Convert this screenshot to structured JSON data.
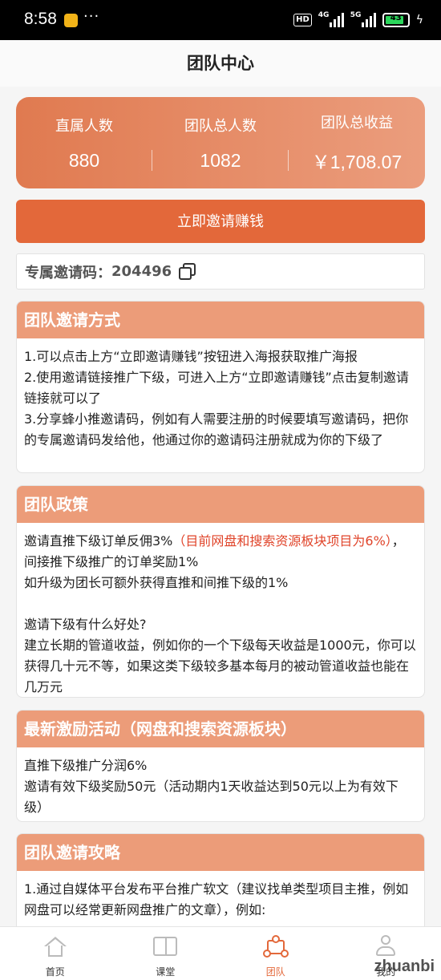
{
  "statusbar": {
    "time": "8:58",
    "dots": "···",
    "hd": "HD",
    "net1": "4G",
    "net2": "5G",
    "battery": "43",
    "bolt": "ϟ"
  },
  "header": {
    "title": "团队中心"
  },
  "stats": [
    {
      "label": "直属人数",
      "value": "880"
    },
    {
      "label": "团队总人数",
      "value": "1082"
    },
    {
      "label": "团队总收益",
      "value": "￥1,708.07"
    }
  ],
  "invite_button": "立即邀请赚钱",
  "invite_code": {
    "label": "专属邀请码：",
    "code": "204496"
  },
  "cards": {
    "methods": {
      "title": "团队邀请方式",
      "lines": [
        "1.可以点击上方“立即邀请赚钱”按钮进入海报获取推广海报",
        "2.使用邀请链接推广下级，可进入上方“立即邀请赚钱”点击复制邀请链接就可以了",
        "3.分享蜂小推邀请码，例如有人需要注册的时候要填写邀请码，把你的专属邀请码发给他，他通过你的邀请码注册就成为你的下级了"
      ]
    },
    "policy": {
      "title": "团队政策",
      "line1_a": "邀请直推下级订单反佣3%",
      "line1_red": "（目前网盘和搜索资源板块项目为6%）",
      "line1_b": "，间接推下级推广的订单奖励1%",
      "line2": "如升级为团长可额外获得直推和间推下级的1%",
      "line3": "邀请下级有什么好处?",
      "line4": "建立长期的管道收益，例如你的一个下级每天收益是1000元，你可以获得几十元不等，如果这类下级较多基本每月的被动管道收益也能在几万元"
    },
    "activity": {
      "title": "最新激励活动（网盘和搜索资源板块）",
      "lines": [
        "直推下级推广分润6%",
        "邀请有效下级奖励50元（活动期内1天收益达到50元以上为有效下级）"
      ]
    },
    "strategy": {
      "title": "团队邀请攻略",
      "lines": [
        "1.通过自媒体平台发布平台推广软文（建议找单类型项目主推，例如网盘可以经常更新网盘推广的文章），例如:"
      ]
    }
  },
  "tabbar": [
    {
      "label": "首页",
      "icon": "home-icon"
    },
    {
      "label": "课堂",
      "icon": "book-icon"
    },
    {
      "label": "团队",
      "icon": "team-icon"
    },
    {
      "label": "我的",
      "icon": "user-icon"
    }
  ],
  "watermark": "zhuanbi",
  "colors": {
    "accent": "#e3683a",
    "card_header": "#ec9c79",
    "highlight": "#e0442a"
  }
}
